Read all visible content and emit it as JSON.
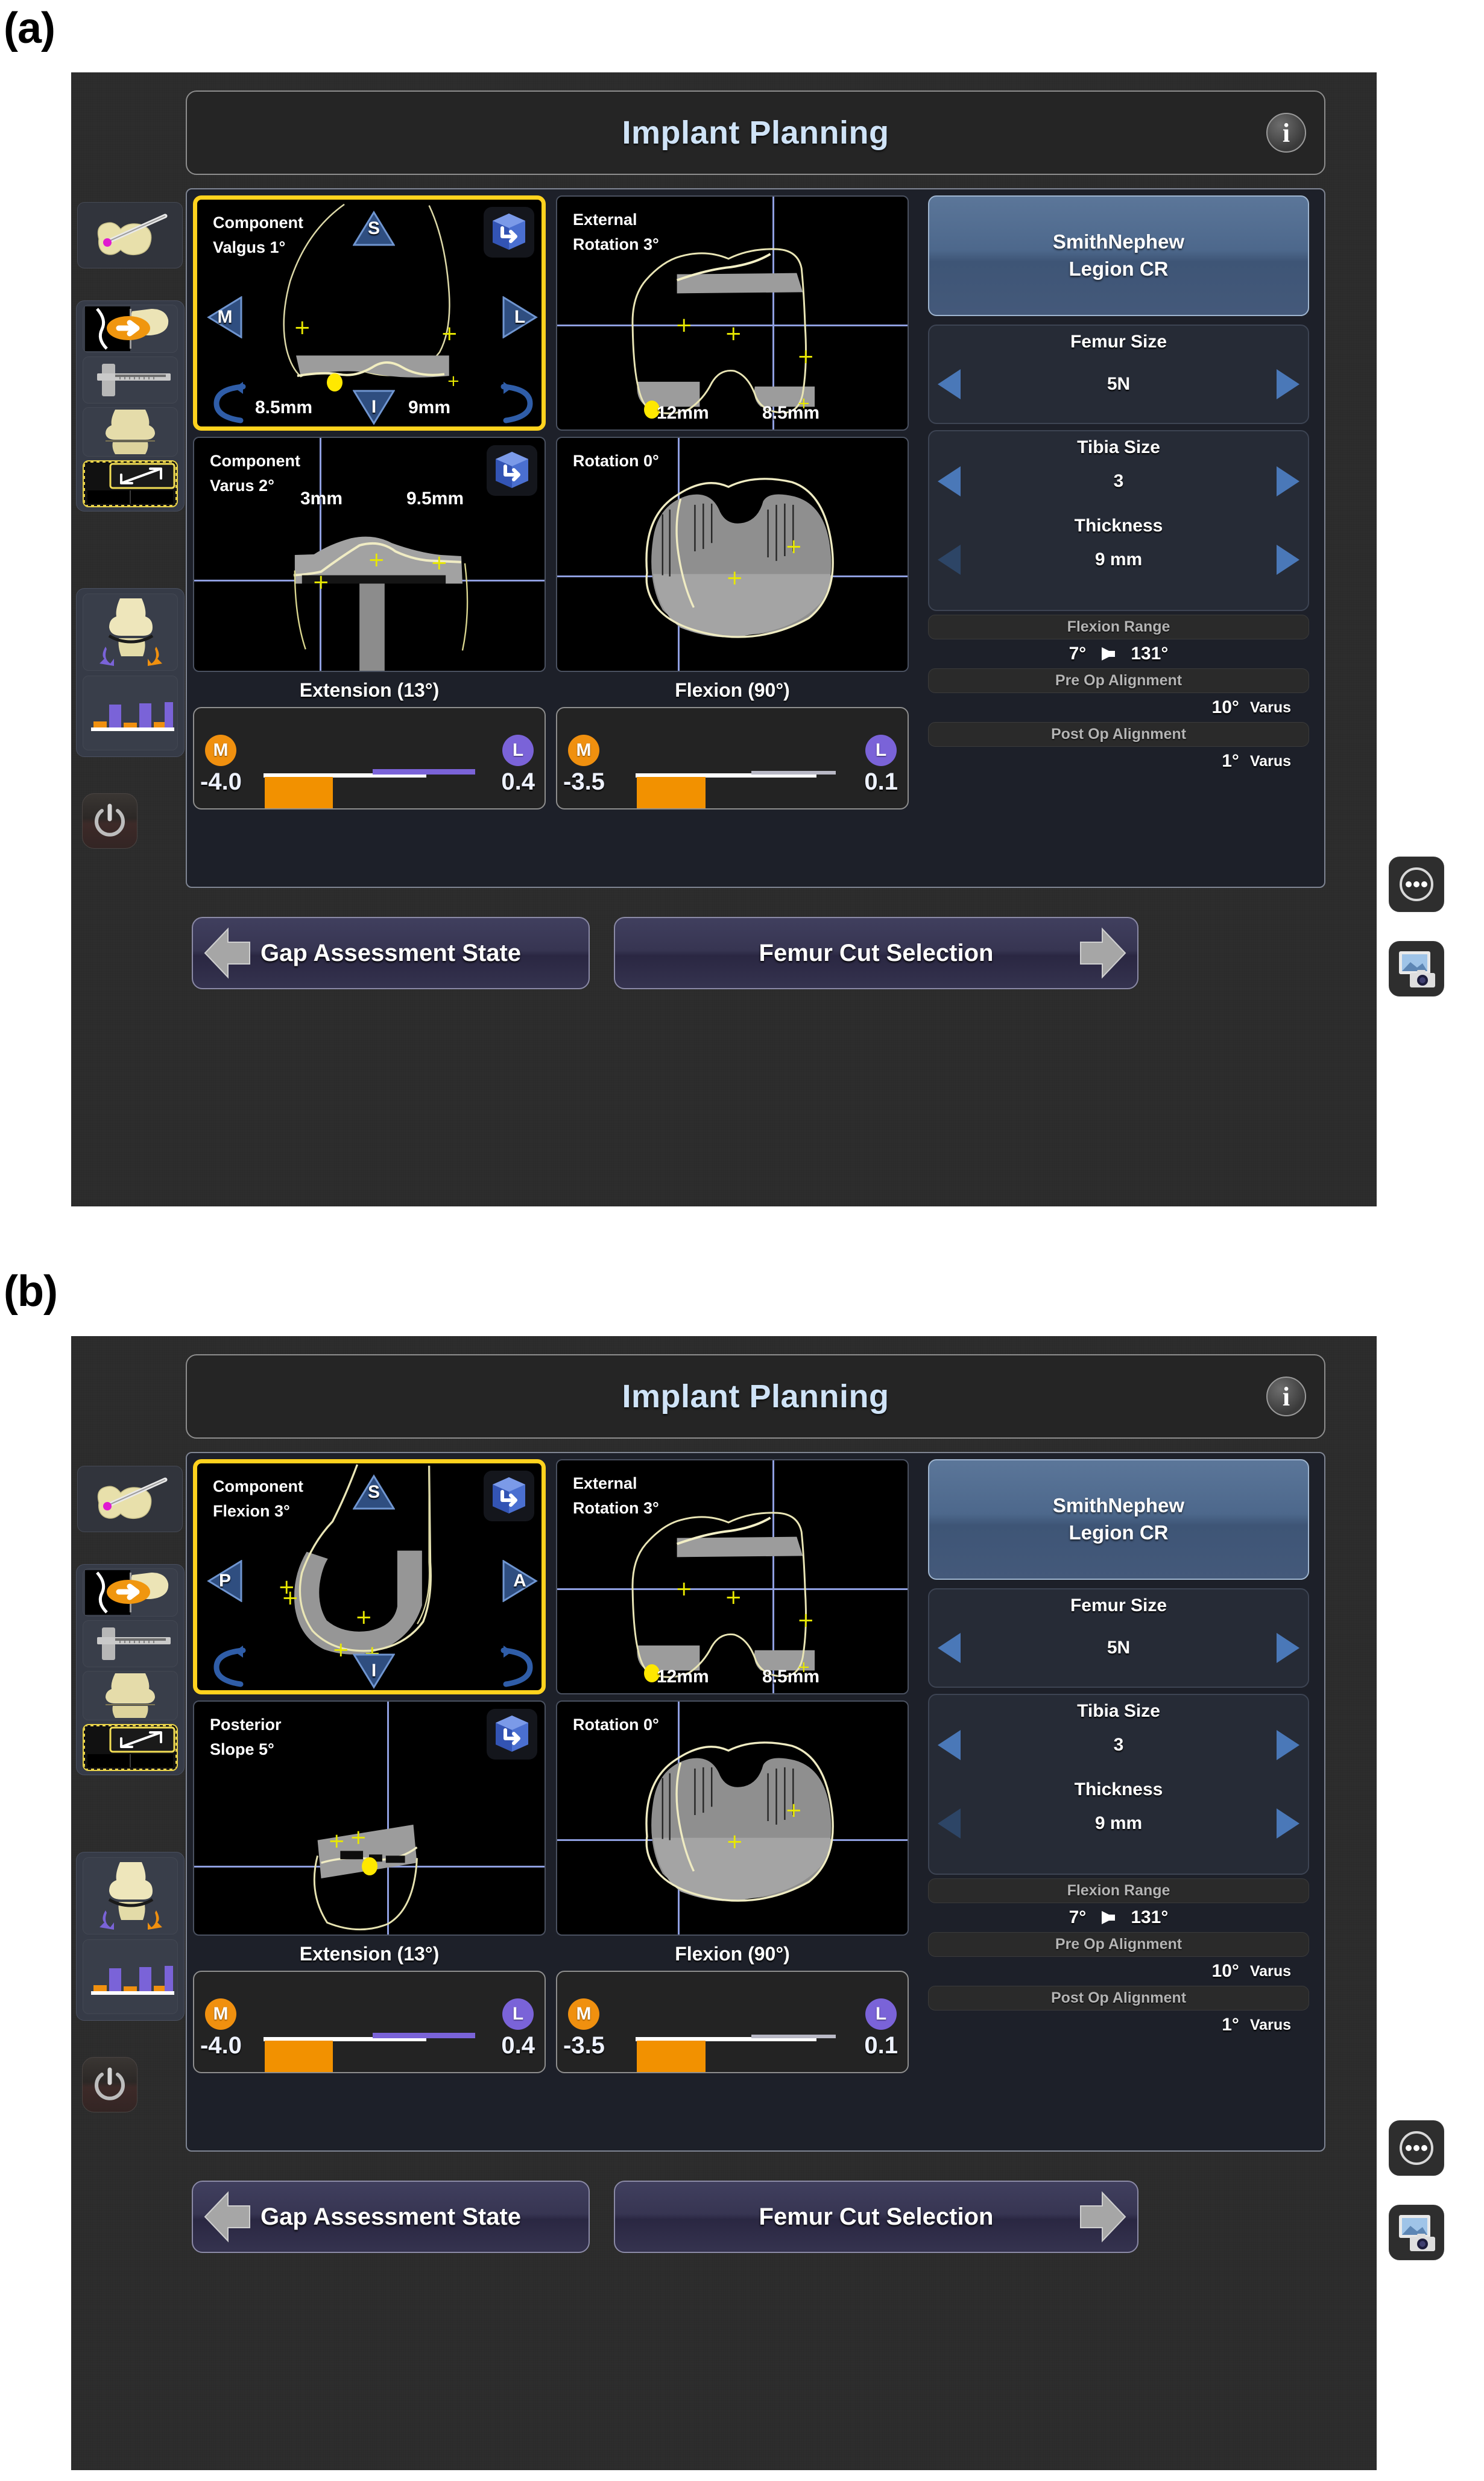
{
  "figure": {
    "panel_a_label": "(a)",
    "panel_b_label": "(b)"
  },
  "header": {
    "title": "Implant Planning",
    "info_icon": "info-icon",
    "info_glyph": "i"
  },
  "left_rail": {
    "items": [
      {
        "name": "registration-probe-icon",
        "label": "Registration"
      },
      {
        "name": "navigation-femur-icon",
        "label": "Navigation"
      },
      {
        "name": "caliper-icon",
        "label": "Measurement"
      },
      {
        "name": "knee-model-icon",
        "label": "Knee Model"
      },
      {
        "name": "expand-view-icon",
        "label": "Layout"
      },
      {
        "name": "knee-rotation-icon",
        "label": "Kinematics"
      },
      {
        "name": "gap-bars-icon",
        "label": "Gap Graph"
      }
    ],
    "power_button": "power-icon"
  },
  "float_buttons": [
    {
      "name": "more-options-button",
      "glyph": "•••"
    },
    {
      "name": "screenshot-button",
      "glyph": "screen-capture-icon"
    }
  ],
  "panel_a": {
    "viewports": [
      {
        "id": "vp-coronal-femur",
        "label": "Component\nValgus 1°",
        "selected": true,
        "nav_top": "S",
        "nav_bottom": "I",
        "nav_left": "M",
        "nav_right": "L",
        "measure_left": "8.5mm",
        "measure_right": "9mm",
        "cube_icon": "rotate-cube-icon"
      },
      {
        "id": "vp-axial-femur",
        "label": "External\nRotation 3°",
        "selected": false,
        "measure_left": "12mm",
        "measure_right": "8.5mm"
      },
      {
        "id": "vp-coronal-tibia",
        "label": "Component\nVarus 2°",
        "selected": false,
        "measure_left": "3mm",
        "measure_right": "9.5mm",
        "cube_icon": "rotate-cube-icon"
      },
      {
        "id": "vp-axial-tibia",
        "label": "Rotation 0°",
        "selected": false
      }
    ]
  },
  "panel_b": {
    "viewports": [
      {
        "id": "vp-sagittal-femur",
        "label": "Component\nFlexion  3°",
        "selected": true,
        "nav_top": "S",
        "nav_bottom": "I",
        "nav_left": "P",
        "nav_right": "A",
        "cube_icon": "rotate-cube-icon"
      },
      {
        "id": "vp-axial-femur",
        "label": "External\nRotation 3°",
        "selected": false,
        "measure_left": "12mm",
        "measure_right": "8.5mm"
      },
      {
        "id": "vp-sagittal-tibia",
        "label": "Posterior\nSlope 5°",
        "selected": false,
        "cube_icon": "rotate-cube-icon"
      },
      {
        "id": "vp-axial-tibia",
        "label": "Rotation 0°",
        "selected": false
      }
    ]
  },
  "rail": {
    "implant_line1": "SmithNephew",
    "implant_line2": "Legion CR",
    "femur_size_label": "Femur Size",
    "femur_size_value": "5N",
    "tibia_size_label": "Tibia Size",
    "tibia_size_value": "3",
    "thickness_label": "Thickness",
    "thickness_value": "9 mm",
    "flexion_range_label": "Flexion Range",
    "flexion_min": "7°",
    "flexion_max": "131°",
    "pre_op_label": "Pre Op Alignment",
    "pre_op_value": "10°",
    "pre_op_unit": "Varus",
    "post_op_label": "Post Op Alignment",
    "post_op_value": "1°",
    "post_op_unit": "Varus",
    "prev_arrow": "chevron-left-icon",
    "next_arrow": "chevron-right-icon"
  },
  "gap": {
    "extension_title": "Extension (13°)",
    "flexion_title": "Flexion (90°)",
    "extension": {
      "medial_badge": "M",
      "lateral_badge": "L",
      "medial_value": "-4.0",
      "lateral_value": "0.4"
    },
    "flexion": {
      "medial_badge": "M",
      "lateral_badge": "L",
      "medial_value": "-3.5",
      "lateral_value": "0.1"
    }
  },
  "footer": {
    "back_label": "Gap Assessment State",
    "next_label": "Femur Cut Selection",
    "back_icon": "arrow-left-icon",
    "next_icon": "arrow-right-icon"
  },
  "colors": {
    "accent_yellow": "#ffd21e",
    "medial_orange": "#f29100",
    "lateral_purple": "#7a63d8",
    "title_blue": "#cfe3f7",
    "implant_blue": "#4d688c"
  }
}
